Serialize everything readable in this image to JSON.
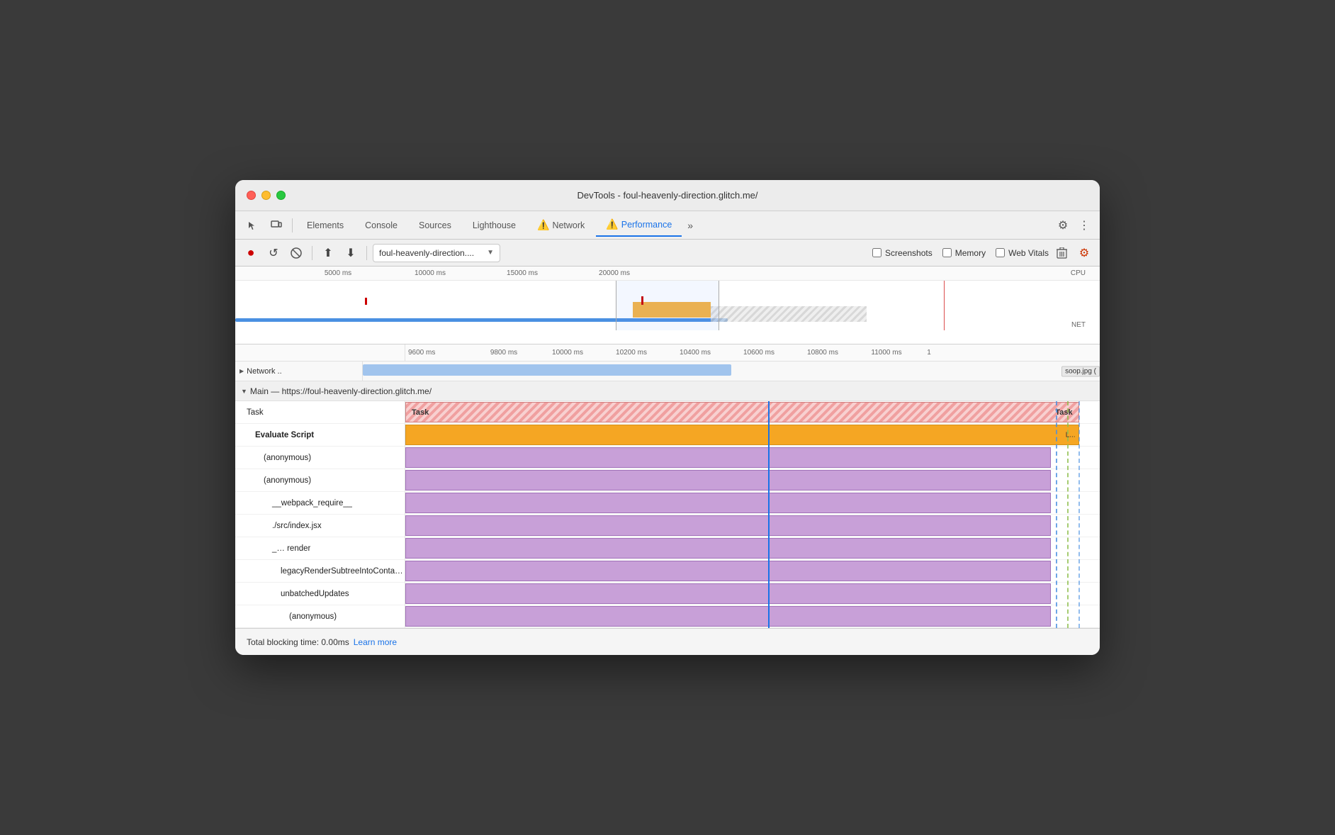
{
  "window": {
    "title": "DevTools - foul-heavenly-direction.glitch.me/"
  },
  "tabs": {
    "items": [
      {
        "label": "Elements",
        "active": false
      },
      {
        "label": "Console",
        "active": false
      },
      {
        "label": "Sources",
        "active": false
      },
      {
        "label": "Lighthouse",
        "active": false
      },
      {
        "label": "Network",
        "active": false,
        "warning": true
      },
      {
        "label": "Performance",
        "active": true,
        "warning": true
      }
    ],
    "more_label": "»"
  },
  "toolbar": {
    "record_label": "●",
    "reload_label": "↺",
    "clear_label": "🚫",
    "upload_label": "⬆",
    "download_label": "⬇",
    "url_value": "foul-heavenly-direction....",
    "screenshots_label": "Screenshots",
    "memory_label": "Memory",
    "web_vitals_label": "Web Vitals",
    "trash_label": "🗑",
    "gear_label": "⚙"
  },
  "timeline": {
    "ruler_marks": [
      "5000 ms",
      "10000 ms",
      "15000 ms",
      "20000 ms"
    ],
    "cpu_label": "CPU",
    "net_label": "NET",
    "flame_marks": [
      "9600 ms",
      "9800 ms",
      "10000 ms",
      "10200 ms",
      "10400 ms",
      "10600 ms",
      "10800 ms",
      "11000 ms",
      "1"
    ]
  },
  "network_row": {
    "label": "Network ..",
    "soop_label": "soop.jpg ("
  },
  "main": {
    "header": "Main — https://foul-heavenly-direction.glitch.me/",
    "rows": [
      {
        "label": "Task",
        "type": "task",
        "indent": 0
      },
      {
        "label": "Evaluate Script",
        "type": "evaluate",
        "indent": 1
      },
      {
        "label": "(anonymous)",
        "type": "purple",
        "indent": 2
      },
      {
        "label": "(anonymous)",
        "type": "purple",
        "indent": 2
      },
      {
        "label": "__webpack_require__",
        "type": "purple",
        "indent": 3
      },
      {
        "label": "./src/index.jsx",
        "type": "purple",
        "indent": 3
      },
      {
        "label": "_…  render",
        "type": "purple",
        "indent": 3
      },
      {
        "label": "legacyRenderSubtreeIntoContainer",
        "type": "purple",
        "indent": 4
      },
      {
        "label": "unbatchedUpdates",
        "type": "purple",
        "indent": 4
      },
      {
        "label": "(anonymous)",
        "type": "purple",
        "indent": 5
      }
    ]
  },
  "status_bar": {
    "tbt_label": "Total blocking time: 0.00ms",
    "learn_more_label": "Learn more"
  }
}
